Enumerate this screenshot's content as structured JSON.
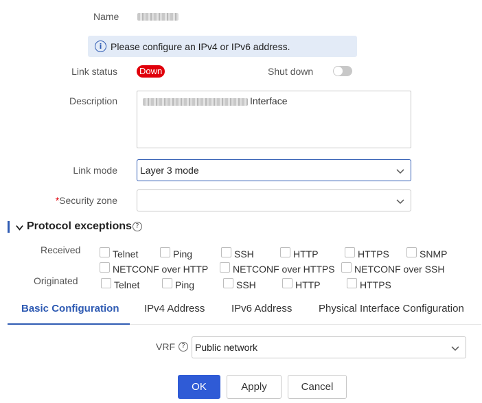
{
  "form": {
    "name_label": "Name",
    "info_message": "Please configure an IPv4 or IPv6 address.",
    "link_status_label": "Link status",
    "link_status_value": "Down",
    "shutdown_label": "Shut down",
    "description_label": "Description",
    "description_value_suffix": "Interface",
    "link_mode_label": "Link mode",
    "link_mode_value": "Layer 3 mode",
    "security_zone_required": "*",
    "security_zone_label": "Security zone",
    "security_zone_value": ""
  },
  "protocol_exceptions": {
    "title": "Protocol exceptions",
    "received_label": "Received",
    "originated_label": "Originated",
    "received": [
      "Telnet",
      "Ping",
      "SSH",
      "HTTP",
      "HTTPS",
      "SNMP",
      "NETCONF over HTTP",
      "NETCONF over HTTPS",
      "NETCONF over SSH"
    ],
    "originated": [
      "Telnet",
      "Ping",
      "SSH",
      "HTTP",
      "HTTPS"
    ]
  },
  "tabs": [
    "Basic Configuration",
    "IPv4 Address",
    "IPv6 Address",
    "Physical Interface Configuration"
  ],
  "vrf": {
    "label": "VRF",
    "value": "Public network"
  },
  "buttons": {
    "ok": "OK",
    "apply": "Apply",
    "cancel": "Cancel"
  },
  "colors": {
    "accent": "#2f5bb3",
    "danger": "#e0000b",
    "primary_button": "#2f5bd6"
  }
}
